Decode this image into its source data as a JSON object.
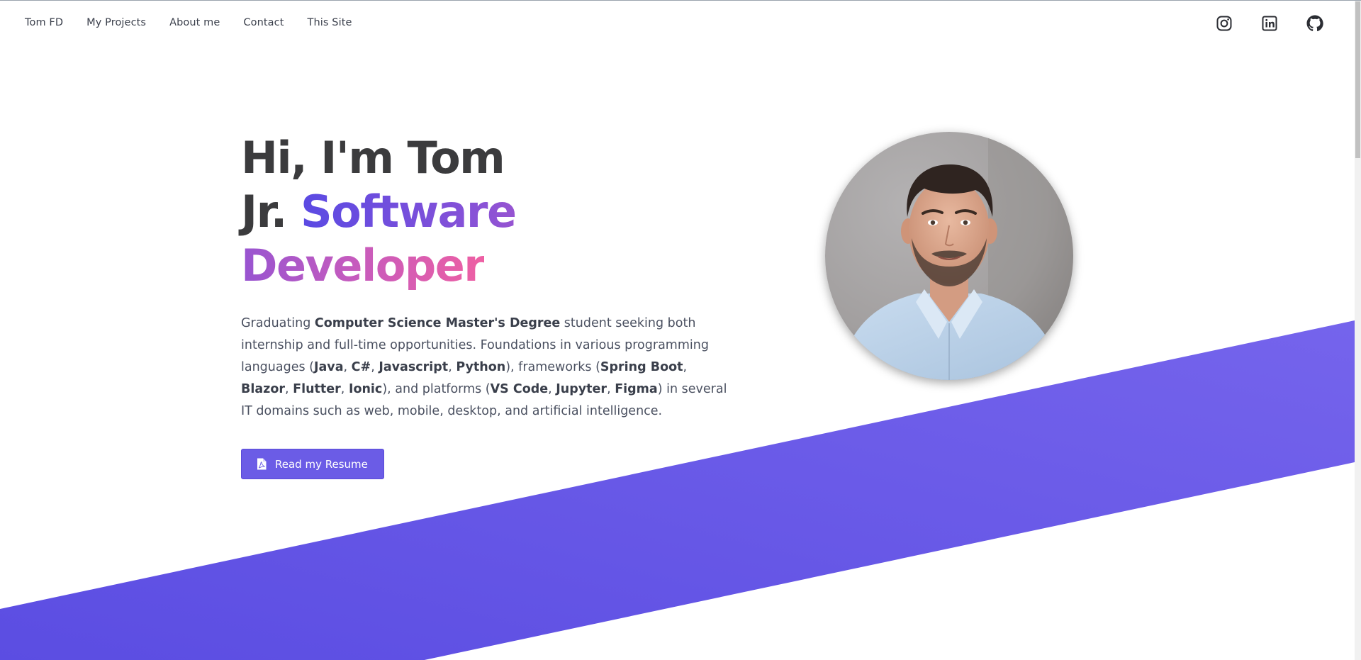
{
  "nav": {
    "links": [
      "Tom FD",
      "My Projects",
      "About me",
      "Contact",
      "This Site"
    ],
    "social": [
      {
        "name": "instagram-icon"
      },
      {
        "name": "linkedin-icon"
      },
      {
        "name": "github-icon"
      }
    ]
  },
  "hero": {
    "line1": "Hi, I'm Tom",
    "line2_prefix": "Jr. ",
    "line2_highlight": "Software Developer",
    "intro": [
      {
        "t": "Graduating "
      },
      {
        "t": "Computer Science Master's Degree",
        "b": true
      },
      {
        "t": " student seeking both internship and full-time opportunities. Foundations in various programming languages ("
      },
      {
        "t": "Java",
        "b": true
      },
      {
        "t": ", "
      },
      {
        "t": "C#",
        "b": true
      },
      {
        "t": ", "
      },
      {
        "t": "Javascript",
        "b": true
      },
      {
        "t": ", "
      },
      {
        "t": "Python",
        "b": true
      },
      {
        "t": "), frameworks ("
      },
      {
        "t": "Spring Boot",
        "b": true
      },
      {
        "t": ", "
      },
      {
        "t": "Blazor",
        "b": true
      },
      {
        "t": ", "
      },
      {
        "t": "Flutter",
        "b": true
      },
      {
        "t": ", "
      },
      {
        "t": "Ionic",
        "b": true
      },
      {
        "t": "), and platforms ("
      },
      {
        "t": "VS Code",
        "b": true
      },
      {
        "t": ", "
      },
      {
        "t": "Jupyter",
        "b": true
      },
      {
        "t": ", "
      },
      {
        "t": "Figma",
        "b": true
      },
      {
        "t": ") in several IT domains such as web, mobile, desktop, and artificial intelligence."
      }
    ],
    "resume_button": "Read my Resume"
  },
  "colors": {
    "accent": "#6b5ce6",
    "band": "#6658e4",
    "heading": "#3b3b3d",
    "body_text": "#4a5060",
    "gradient": [
      "#5a4ae3",
      "#8a52d6",
      "#c35bbf",
      "#ee5fa3"
    ]
  }
}
